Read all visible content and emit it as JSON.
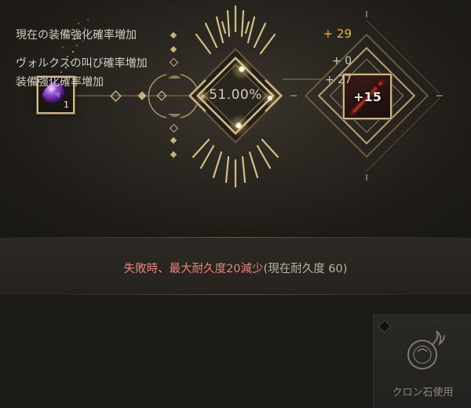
{
  "enhancement": {
    "material_count": "1",
    "success_rate": "51.00%",
    "result_level": "+15"
  },
  "warning": {
    "part_red": "失敗時、最大耐久度20減少",
    "part_normal": "(現在耐久度 60)"
  },
  "bonus": {
    "total_label": "現在の装備強化確率増加",
    "total_value": "+ 29",
    "valks_label": "ヴォルクスの叫び確率増加",
    "valks_value": "+ 0",
    "equip_label": "装備強化確率増加",
    "equip_value": "+ 27"
  },
  "cron": {
    "label": "クロン石使用"
  },
  "colors": {
    "gold": "#cdb98a",
    "warning_red": "#e8827a",
    "bonus_highlight": "#e8b44c"
  }
}
